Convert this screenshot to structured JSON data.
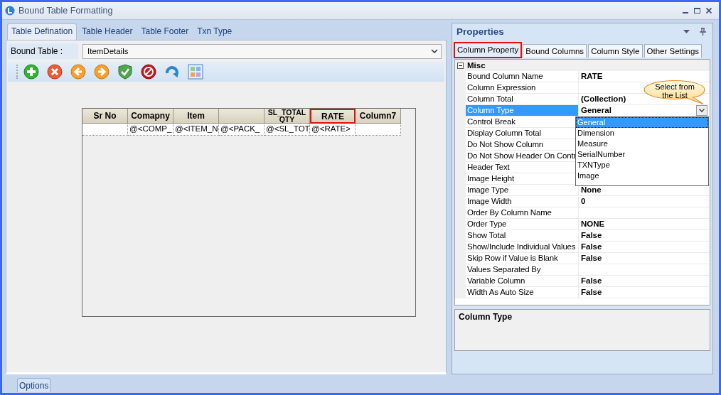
{
  "window": {
    "title": "Bound Table Formatting"
  },
  "tabs": [
    {
      "label": "Table Defination",
      "selected": true
    },
    {
      "label": "Table Header",
      "selected": false
    },
    {
      "label": "Table Footer",
      "selected": false
    },
    {
      "label": "Txn Type",
      "selected": false
    }
  ],
  "bound_table": {
    "label": "Bound Table :",
    "value": "ItemDetails"
  },
  "toolbar": [
    {
      "kind": "add"
    },
    {
      "kind": "delete"
    },
    {
      "kind": "back"
    },
    {
      "kind": "forward"
    },
    {
      "kind": "verify"
    },
    {
      "kind": "stop"
    },
    {
      "kind": "refresh"
    },
    {
      "kind": "layout"
    }
  ],
  "grid": {
    "columns": [
      {
        "header": "Sr No",
        "highlighted": false
      },
      {
        "header": "Comapny",
        "highlighted": false
      },
      {
        "header": "Item",
        "highlighted": false
      },
      {
        "highlighted": false
      },
      {
        "header": "SL_TOTAL QTY",
        "highlighted": false
      },
      {
        "header": "RATE",
        "highlighted": true
      },
      {
        "header": "Column7",
        "highlighted": false
      }
    ],
    "rows": [
      {
        "cells": [
          null,
          "@<COMP_",
          "@<ITEM_N",
          "@<PACK_",
          "@<SL_TOT",
          "@<RATE>",
          null
        ]
      }
    ]
  },
  "properties": {
    "title": "Properties",
    "tabs": [
      {
        "label": "Column Property",
        "selected": true,
        "highlighted": true
      },
      {
        "label": "Bound Columns",
        "selected": false,
        "highlighted": false
      },
      {
        "label": "Column Style",
        "selected": false,
        "highlighted": false
      },
      {
        "label": "Other Settings",
        "selected": false,
        "highlighted": false
      }
    ],
    "category": {
      "label": "Misc",
      "expanded": true
    },
    "rows": [
      {
        "name": "Bound Column Name",
        "value": "RATE",
        "selected": false
      },
      {
        "name": "Column Expression",
        "value": null,
        "selected": false
      },
      {
        "name": "Column Total",
        "value": "(Collection)",
        "selected": false
      },
      {
        "name": "Column Type",
        "value": "General",
        "selected": true
      },
      {
        "name": "Control Break",
        "value": null,
        "selected": false
      },
      {
        "name": "Display Column Total",
        "value": null,
        "selected": false
      },
      {
        "name": "Do Not Show Column",
        "value": null,
        "selected": false
      },
      {
        "name": "Do Not Show Header On Contr",
        "value": null,
        "selected": false
      },
      {
        "name": "Header Text",
        "value": null,
        "selected": false
      },
      {
        "name": "Image Height",
        "value": null,
        "selected": false
      },
      {
        "name": "Image Type",
        "value": "None",
        "selected": false
      },
      {
        "name": "Image Width",
        "value": "0",
        "selected": false
      },
      {
        "name": "Order By Column Name",
        "value": null,
        "selected": false
      },
      {
        "name": "Order Type",
        "value": "NONE",
        "selected": false
      },
      {
        "name": "Show Total",
        "value": "False",
        "selected": false
      },
      {
        "name": "Show/Include Individual Values",
        "value": "False",
        "selected": false
      },
      {
        "name": "Skip Row if Value is Blank",
        "value": "False",
        "selected": false
      },
      {
        "name": "Values Separated By",
        "value": null,
        "selected": false
      },
      {
        "name": "Variable Column",
        "value": "False",
        "selected": false
      },
      {
        "name": "Width As Auto Size",
        "value": "False",
        "selected": false
      }
    ],
    "dropdown": {
      "items": [
        {
          "label": "General",
          "selected": true
        },
        {
          "label": "Dimension",
          "selected": false
        },
        {
          "label": "Measure",
          "selected": false
        },
        {
          "label": "SerialNumber",
          "selected": false
        },
        {
          "label": "TXNType",
          "selected": false
        },
        {
          "label": "Image",
          "selected": false
        }
      ]
    },
    "callout": "Select from the List",
    "description": {
      "title": "Column Type"
    }
  },
  "bottom_tabs": [
    {
      "label": "Options",
      "selected": true
    }
  ]
}
